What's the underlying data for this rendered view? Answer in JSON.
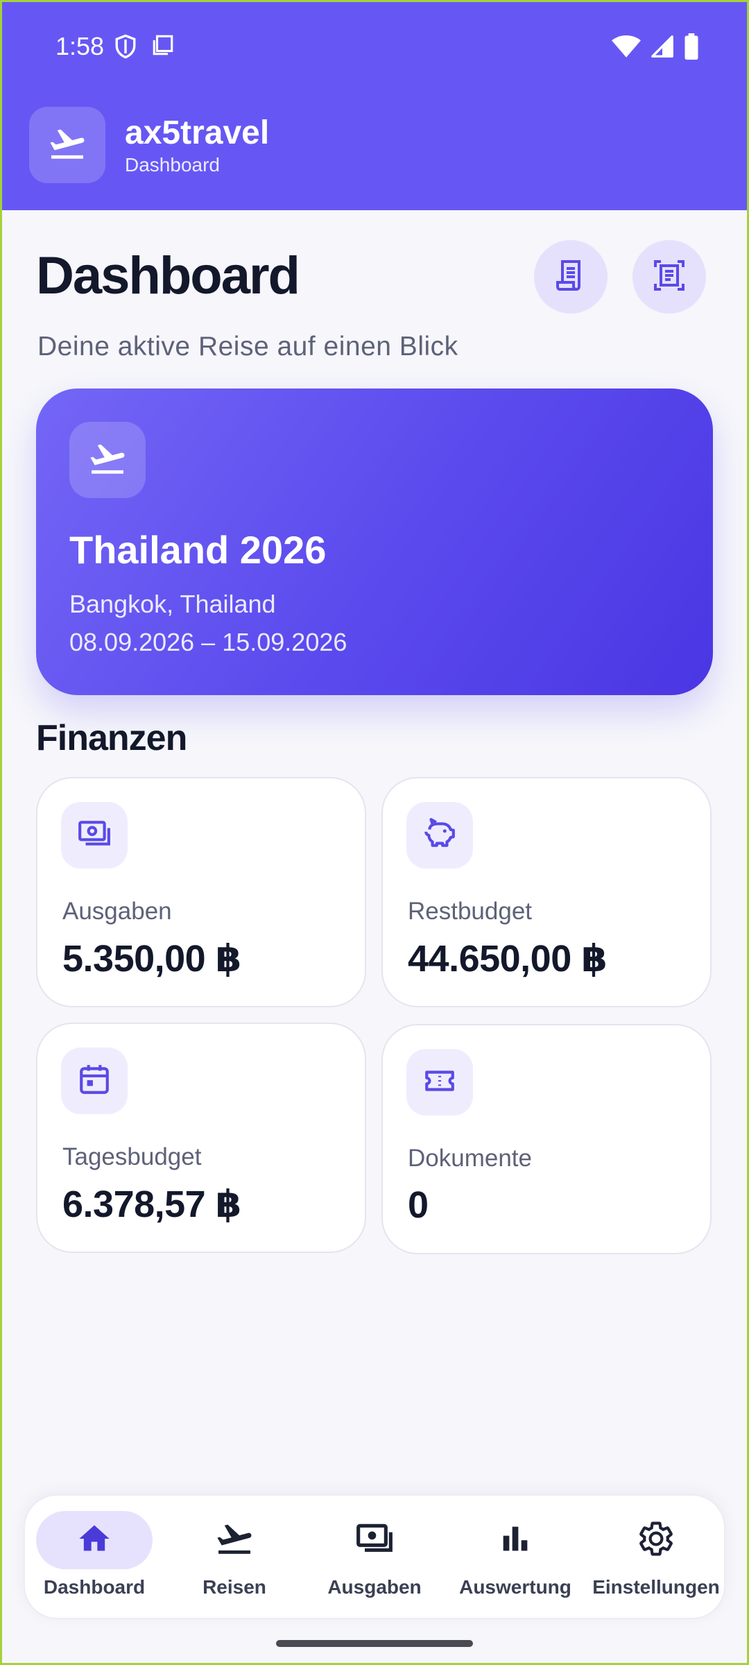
{
  "status_bar": {
    "time": "1:58",
    "icons_left": [
      "shield-icon",
      "copy-icon"
    ],
    "icons_right": [
      "wifi-icon",
      "signal-icon",
      "battery-icon"
    ]
  },
  "app_bar": {
    "logo_icon": "flight-takeoff-icon",
    "app_name": "ax5travel",
    "subtitle": "Dashboard",
    "color": "#6657f4"
  },
  "header": {
    "title": "Dashboard",
    "subtitle": "Deine aktive Reise auf einen Blick",
    "actions": [
      {
        "icon": "receipt-icon"
      },
      {
        "icon": "document-scanner-icon"
      }
    ]
  },
  "active_trip": {
    "icon": "flight-takeoff-icon",
    "name": "Thailand 2026",
    "location": "Bangkok, Thailand",
    "dates": "08.09.2026 – 15.09.2026"
  },
  "finances": {
    "title": "Finanzen",
    "cards": [
      {
        "icon": "payments-icon",
        "label": "Ausgaben",
        "value": "5.350,00 ฿"
      },
      {
        "icon": "piggy-bank-icon",
        "label": "Restbudget",
        "value": "44.650,00 ฿"
      },
      {
        "icon": "calendar-icon",
        "label": "Tagesbudget",
        "value": "6.378,57 ฿"
      },
      {
        "icon": "ticket-icon",
        "label": "Dokumente",
        "value": "0"
      }
    ]
  },
  "bottom_nav": {
    "active": "Dashboard",
    "items": [
      {
        "icon": "home-icon",
        "label": "Dashboard"
      },
      {
        "icon": "flight-takeoff-icon",
        "label": "Reisen"
      },
      {
        "icon": "payments-icon",
        "label": "Ausgaben"
      },
      {
        "icon": "bar-chart-icon",
        "label": "Auswertung"
      },
      {
        "icon": "gear-icon",
        "label": "Einstellungen"
      }
    ]
  },
  "colors": {
    "accent": "#6657f4",
    "text_primary": "#13182b",
    "text_secondary": "#5d6278",
    "icon_tint_bg": "#efedfd"
  }
}
